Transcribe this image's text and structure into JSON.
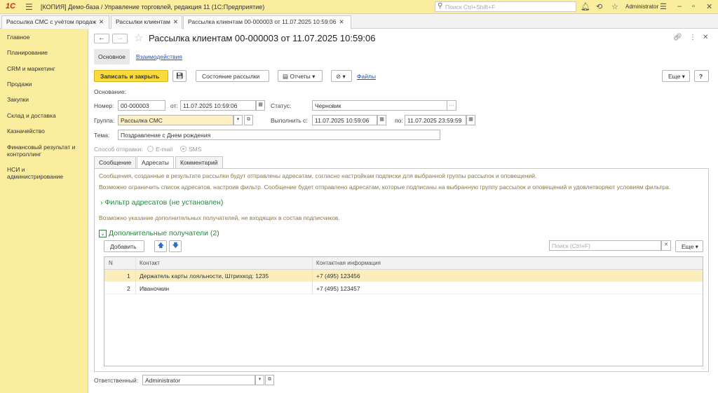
{
  "app": {
    "logo": "1С",
    "title": "[КОПИЯ] Демо-база / Управление торговлей, редакция 11  (1С:Предприятие)",
    "search_placeholder": "Поиск Ctrl+Shift+F",
    "user": "Administrator"
  },
  "tabs": [
    {
      "label": "Рассылка СМС с учётом продаж"
    },
    {
      "label": "Рассылки клиентам"
    },
    {
      "label": "Рассылка клиентам 00-000003 от 11.07.2025 10:59:06"
    }
  ],
  "sidebar": {
    "items": [
      {
        "label": "Главное"
      },
      {
        "label": "Планирование"
      },
      {
        "label": "CRM и маркетинг"
      },
      {
        "label": "Продажи"
      },
      {
        "label": "Закупки"
      },
      {
        "label": "Склад и доставка"
      },
      {
        "label": "Казначейство"
      },
      {
        "label": "Финансовый результат и контроллинг"
      },
      {
        "label": "НСИ и администрирование"
      }
    ]
  },
  "form": {
    "title": "Рассылка клиентам 00-000003 от 11.07.2025 10:59:06",
    "subtabs": {
      "main": "Основное",
      "interactions": "Взаимодействия"
    },
    "toolbar": {
      "save_close": "Записать и закрыть",
      "state": "Состояние рассылки",
      "reports": "Отчеты",
      "files": "Файлы",
      "more": "Еще",
      "help": "?"
    },
    "basis_label": "Основание:",
    "number_label": "Номер:",
    "number_value": "00-000003",
    "date_label": "от:",
    "date_value": "11.07.2025 10:59:06",
    "status_label": "Статус:",
    "status_value": "Черновик",
    "group_label": "Группа:",
    "group_value": "Рассылка СМС",
    "execute_label": "Выполнить с:",
    "execute_from": "11.07.2025 10:59:06",
    "to_label": "по:",
    "execute_to": "11.07.2025 23:59:59",
    "subject_label": "Тема:",
    "subject_value": "Поздравление с Днем рождения",
    "send_method_label": "Способ отправки:",
    "send_email": "E-mail",
    "send_sms": "SMS",
    "page_tabs": {
      "content": "Сообщение",
      "addressees": "Адресаты",
      "comment": "Комментарий"
    },
    "info1": "Сообщения, созданные в результате рассылки будут отправлены адресатам, согласно настройкам подписки для выбранной группы рассылок и оповещений.",
    "info2": "Возможно ограничить список адресатов, настроив фильтр. Сообщение будет отправлено адресатам, которые подписаны на выбранную группу рассылок и оповещений и удовлетворяют условиям фильтра.",
    "filter_group": "Фильтр адресатов (не установлен)",
    "info3": "Возможно указание дополнительных получателей, не входящих в состав подписчиков.",
    "extra_group": "Дополнительные получатели (2)",
    "add_button": "Добавить",
    "grid_search_placeholder": "Поиск (Ctrl+F)",
    "grid_more": "Еще",
    "grid": {
      "columns": [
        "N",
        "Контакт",
        "Контактная информация"
      ],
      "rows": [
        {
          "n": "1",
          "contact": "Держатель карты лояльности, Штрихкод: 1235",
          "info": "+7 (495) 123456"
        },
        {
          "n": "2",
          "contact": "Иваночкин",
          "info": "+7 (495) 123457"
        }
      ]
    },
    "responsible_label": "Ответственный:",
    "responsible_value": "Administrator"
  }
}
